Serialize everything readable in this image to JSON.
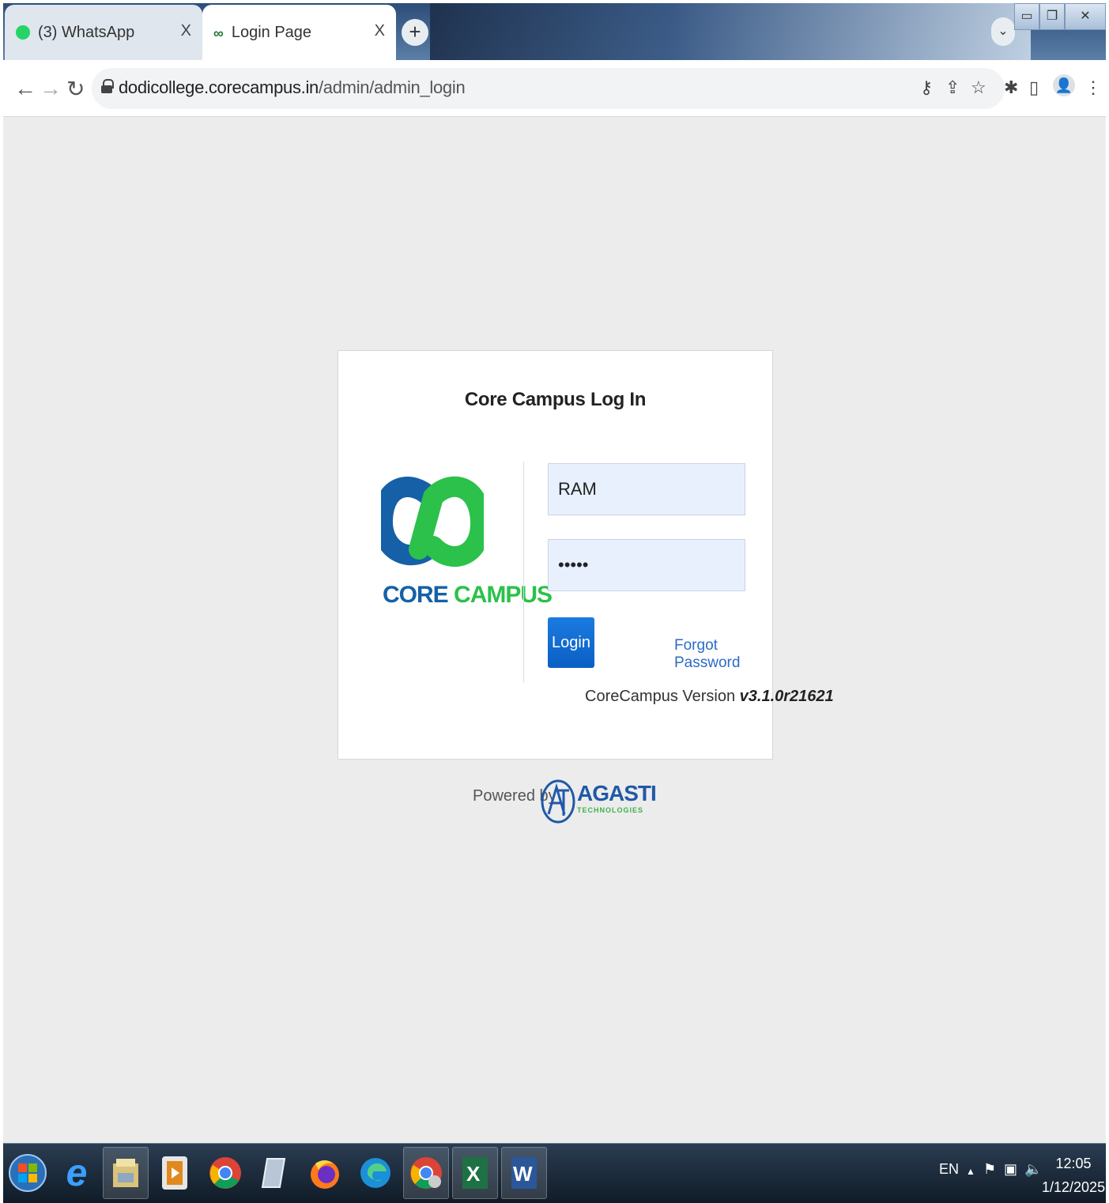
{
  "browser": {
    "tabs": [
      {
        "title": "(3) WhatsApp",
        "icon": "whatsapp-icon"
      },
      {
        "title": "Login Page",
        "icon": "corecampus-icon"
      }
    ],
    "tab_close": "X",
    "new_tab": "+",
    "url_host": "dodicollege.corecampus.in",
    "url_path": "/admin/admin_login"
  },
  "login": {
    "title": "Core Campus Log In",
    "logo_text_1": "CORE",
    "logo_text_2": "CAMPUS",
    "username_value": "RAM",
    "password_value": "•••••",
    "login_label": "Login",
    "forgot_label": "Forgot Password",
    "version_label": "CoreCampus Version",
    "version_value": "v3.1.0r21621"
  },
  "footer": {
    "powered_by": "Powered by",
    "brand": "AGASTI",
    "brand_sub": "TECHNOLOGIES"
  },
  "taskbar": {
    "lang": "EN",
    "time": "12:05",
    "date": "1/12/2025"
  },
  "colors": {
    "brand_blue": "#1560a7",
    "brand_green": "#2bc14a",
    "button_blue": "#0a5fc4",
    "link_blue": "#2a6bc7",
    "field_bg": "#e8f0fe"
  }
}
